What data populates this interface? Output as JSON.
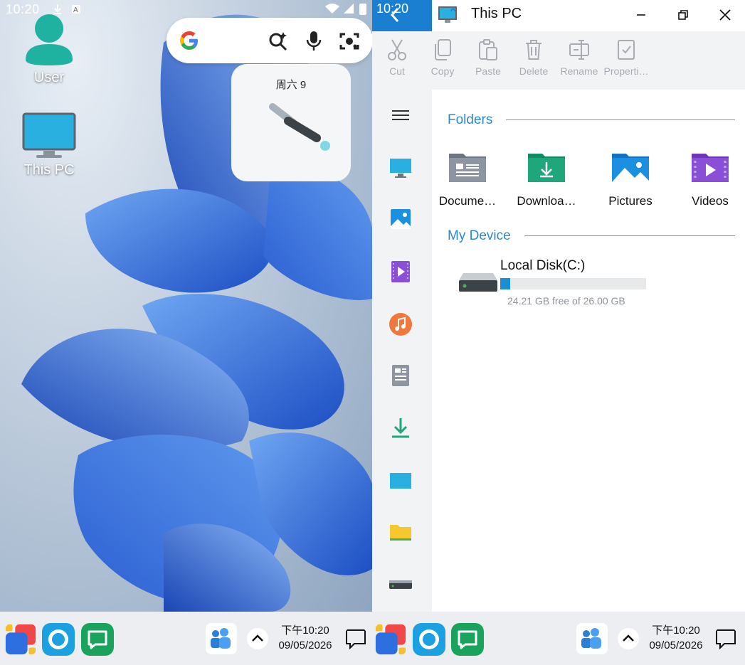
{
  "left": {
    "status": {
      "time": "10:20"
    },
    "desktop_icons": [
      {
        "label": "User",
        "icon": "user-icon"
      },
      {
        "label": "This PC",
        "icon": "monitor-icon"
      }
    ],
    "clock_widget": {
      "date": "周六 9"
    },
    "taskbar": {
      "time": "下午10:20",
      "date": "09/05/2026"
    }
  },
  "right": {
    "status": {
      "time": "10:20"
    },
    "window": {
      "title": "This PC"
    },
    "ribbon": [
      {
        "label": "Cut",
        "icon": "scissors-icon"
      },
      {
        "label": "Copy",
        "icon": "copy-icon"
      },
      {
        "label": "Paste",
        "icon": "paste-icon"
      },
      {
        "label": "Delete",
        "icon": "trash-icon"
      },
      {
        "label": "Rename",
        "icon": "rename-icon"
      },
      {
        "label": "Properti…",
        "icon": "properties-icon"
      }
    ],
    "sections": {
      "folders": "Folders",
      "device": "My Device"
    },
    "folders": [
      {
        "label": "Docume…",
        "icon": "documents-folder-icon",
        "color": "#8d95a3"
      },
      {
        "label": "Downloa…",
        "icon": "downloads-folder-icon",
        "color": "#1fa67a"
      },
      {
        "label": "Pictures",
        "icon": "pictures-folder-icon",
        "color": "#1b8fe0"
      },
      {
        "label": "Videos",
        "icon": "videos-folder-icon",
        "color": "#8a4fd6"
      }
    ],
    "disk": {
      "name": "Local Disk(C:)",
      "free_text": "24.21 GB free of 26.00 GB",
      "used_fraction": 0.069
    },
    "taskbar": {
      "time": "下午10:20",
      "date": "09/05/2026"
    }
  }
}
